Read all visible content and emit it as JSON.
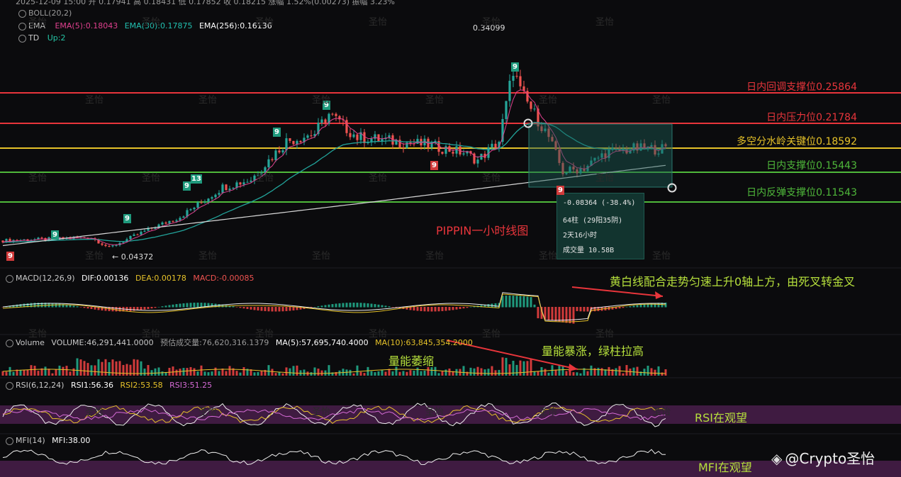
{
  "header": {
    "ohlc_line": "2025-12-09 15:00 开 0.17941 高 0.18431 低 0.17852 收 0.18215 涨幅 1.52%(0.00273) 振幅 3.23%",
    "boll": "BOLL(20,2)",
    "ema_name": "EMA",
    "ema5": "EMA(5):0.18043",
    "ema30": "EMA(30):0.17875",
    "ema256": "EMA(256):0.16136",
    "td_name": "TD",
    "td_val": "Up:2"
  },
  "price_annotations": {
    "high": "0.34099",
    "low": "← 0.04372"
  },
  "levels": [
    {
      "label": "日内回调支撑位0.25864",
      "value": 0.25864,
      "color": "#e8353b"
    },
    {
      "label": "日内压力位0.21784",
      "value": 0.21784,
      "color": "#e8353b"
    },
    {
      "label": "多空分水岭关键位0.18592",
      "value": 0.18592,
      "color": "#e6c229"
    },
    {
      "label": "日内支撑位0.15443",
      "value": 0.15443,
      "color": "#4fb83a"
    },
    {
      "label": "日内反弹支撑位0.11543",
      "value": 0.11543,
      "color": "#4fb83a"
    }
  ],
  "chart_title": "PIPPIN一小时线图",
  "measure_tooltip": {
    "change": "-0.08364 (-38.4%)",
    "bars": "64柱 (29阳35阴)",
    "duration": "2天16小时",
    "volume": "成交量 10.58B"
  },
  "td_marks": [
    "9",
    "9",
    "9",
    "9",
    "13",
    "9",
    "9",
    "9",
    "9",
    "9"
  ],
  "macd": {
    "name": "MACD(12,26,9)",
    "dif": "DIF:0.00136",
    "dea": "DEA:0.00178",
    "macd": "MACD:-0.00085",
    "note": "黄白线配合走势匀速上升0轴上方，由死叉转金叉"
  },
  "volume": {
    "name": "Volume",
    "vol": "VOLUME:46,291,441.0000",
    "est": "预估成交量:76,620,316.1379",
    "ma5": "MA(5):57,695,740.4000",
    "ma10": "MA(10):63,845,354.2000",
    "note_shrink": "量能萎缩",
    "note_surge": "量能暴涨，绿柱拉高"
  },
  "rsi": {
    "name": "RSI(6,12,24)",
    "rsi1": "RSI1:56.36",
    "rsi2": "RSI2:53.58",
    "rsi3": "RSI3:51.25",
    "note": "RSI在观望"
  },
  "mfi": {
    "name": "MFI(14)",
    "mfi": "MFI:38.00",
    "note": "MFI在观望"
  },
  "watermark": "圣怡",
  "brand": "@Crypto圣怡",
  "colors": {
    "up": "#26a69a",
    "down": "#ef5350",
    "ema5": "#e0408e",
    "ema30": "#22a39a",
    "ema256": "#d8d8d8"
  },
  "chart_data": {
    "type": "candlestick",
    "title": "PIPPIN一小时线图",
    "price_range": [
      0.03,
      0.36
    ],
    "key_levels": [
      0.25864,
      0.21784,
      0.18592,
      0.15443,
      0.11543
    ],
    "marked_high": 0.34099,
    "marked_low": 0.04372
  }
}
